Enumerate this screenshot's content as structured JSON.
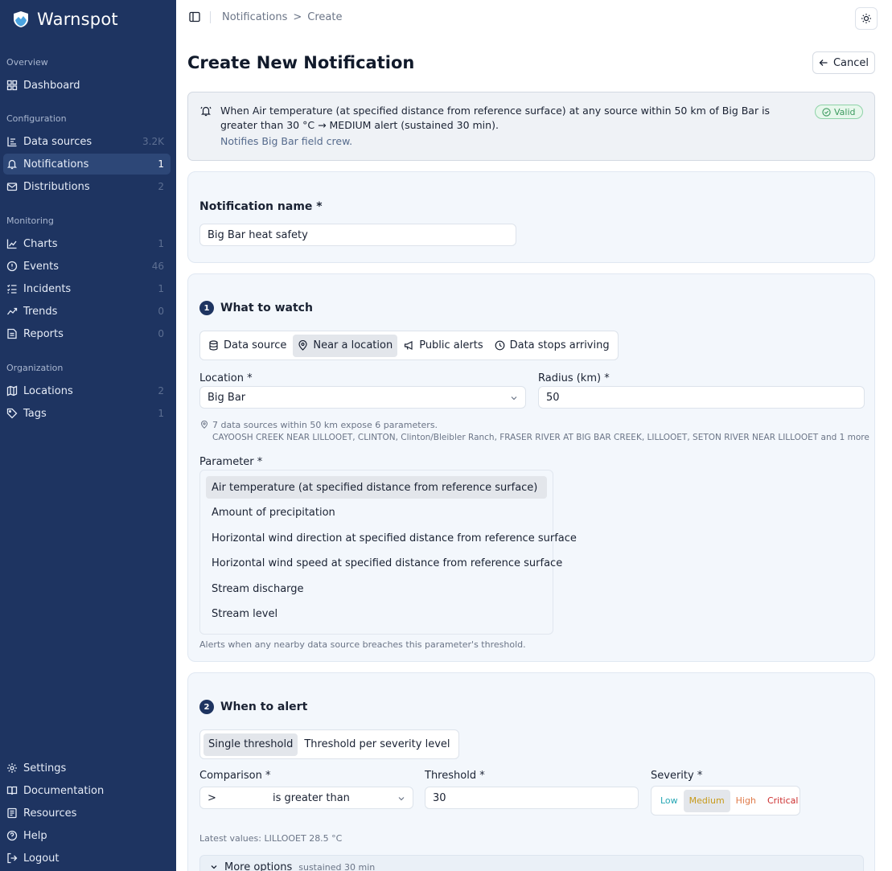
{
  "brand": {
    "name": "Warnspot"
  },
  "sidebar": {
    "sections": {
      "overview": "Overview",
      "configuration": "Configuration",
      "monitoring": "Monitoring",
      "organization": "Organization"
    },
    "items": {
      "dashboard": {
        "label": "Dashboard",
        "count": ""
      },
      "data_sources": {
        "label": "Data sources",
        "count": "3.2K"
      },
      "notifications": {
        "label": "Notifications",
        "count": "1"
      },
      "distributions": {
        "label": "Distributions",
        "count": "2"
      },
      "charts": {
        "label": "Charts",
        "count": "1"
      },
      "events": {
        "label": "Events",
        "count": "46"
      },
      "incidents": {
        "label": "Incidents",
        "count": "1"
      },
      "trends": {
        "label": "Trends",
        "count": "0"
      },
      "reports": {
        "label": "Reports",
        "count": "0"
      },
      "locations": {
        "label": "Locations",
        "count": "2"
      },
      "tags": {
        "label": "Tags",
        "count": "1"
      },
      "settings": {
        "label": "Settings"
      },
      "documentation": {
        "label": "Documentation"
      },
      "resources": {
        "label": "Resources"
      },
      "help": {
        "label": "Help"
      },
      "logout": {
        "label": "Logout"
      }
    }
  },
  "breadcrumb": {
    "parent": "Notifications",
    "separator": ">",
    "current": "Create"
  },
  "page": {
    "title": "Create New Notification",
    "cancel_label": "Cancel"
  },
  "summary": {
    "text": "When Air temperature (at specified distance from reference surface) at any source within 50 km of Big Bar is greater than 30 °C → MEDIUM alert (sustained 30 min).",
    "sub": "Notifies Big Bar field crew.",
    "badge": "Valid"
  },
  "name_card": {
    "label": "Notification name *",
    "value": "Big Bar heat safety"
  },
  "watch": {
    "step": "1",
    "title": "What to watch",
    "tabs": {
      "data_source": "Data source",
      "near_location": "Near a location",
      "public_alerts": "Public alerts",
      "data_stops": "Data stops arriving"
    },
    "location_label": "Location *",
    "location_value": "Big Bar",
    "radius_label": "Radius (km) *",
    "radius_value": "50",
    "sources_hint": "7 data sources within 50 km expose 6 parameters.",
    "sources_list": "CAYOOSH CREEK NEAR LILLOOET, CLINTON, Clinton/Bleibler Ranch, FRASER RIVER AT BIG BAR CREEK, LILLOOET, SETON RIVER NEAR LILLOOET and 1 more",
    "parameter_label": "Parameter *",
    "parameters": [
      "Air temperature (at specified distance from reference surface)",
      "Amount of precipitation",
      "Horizontal wind direction at specified distance from reference surface",
      "Horizontal wind speed at specified distance from reference surface",
      "Stream discharge",
      "Stream level"
    ],
    "parameter_hint": "Alerts when any nearby data source breaches this parameter's threshold."
  },
  "alert": {
    "step": "2",
    "title": "When to alert",
    "modes": {
      "single": "Single threshold",
      "per_severity": "Threshold per severity level"
    },
    "comparison_label": "Comparison *",
    "comparison_symbol": ">",
    "comparison_value": "is greater than",
    "threshold_label": "Threshold *",
    "threshold_value": "30",
    "severity_label": "Severity *",
    "severities": {
      "low": "Low",
      "medium": "Medium",
      "high": "High",
      "critical": "Critical"
    },
    "latest": "Latest values: LILLOOET 28.5 °C",
    "more_label": "More options",
    "more_hint": "sustained 30 min"
  },
  "colors": {
    "sidebar_bg": "#1e3461",
    "accent": "#1e3461",
    "low": "#27a7b5",
    "medium": "#c79a1a",
    "high": "#e07b4a",
    "critical": "#cc2e2e",
    "valid": "#3c9a5f"
  }
}
